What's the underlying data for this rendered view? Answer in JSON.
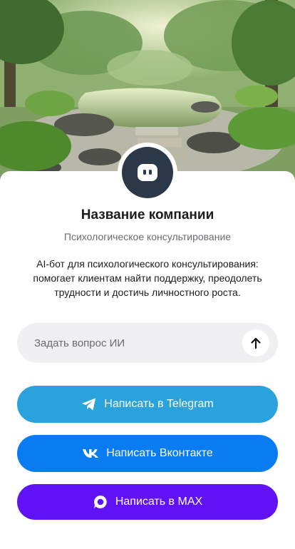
{
  "company": {
    "name": "Название компании",
    "category": "Психологическое консультирование",
    "description": "AI-бот для психологического консультирования: помогает клиентам найти поддержку, преодолеть трудности и достичь личностного роста."
  },
  "ask": {
    "placeholder": "Задать вопрос ИИ"
  },
  "buttons": {
    "telegram": {
      "label": "Написать в Telegram",
      "color": "#2aa3dd",
      "icon": "telegram-icon"
    },
    "vk": {
      "label": "Написать Вконтакте",
      "color": "#0a7cf2",
      "icon": "vk-icon"
    },
    "max": {
      "label": "Написать в MAX",
      "color": "#6112f5",
      "icon": "max-icon"
    }
  },
  "avatar": {
    "icon": "bot-icon",
    "color": "#2b3848"
  }
}
